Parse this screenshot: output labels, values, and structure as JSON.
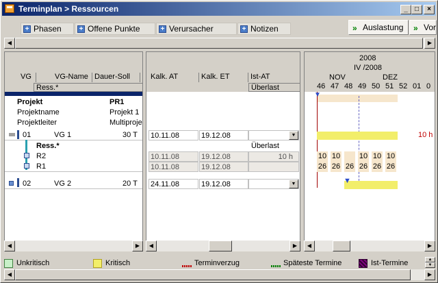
{
  "window": {
    "title": "Terminplan > Ressourcen",
    "btn_min": "_",
    "btn_max": "□",
    "btn_close": "×"
  },
  "toolbar": {
    "phasen": "Phasen",
    "offene_punkte": "Offene Punkte",
    "verursacher": "Verursacher",
    "notizen": "Notizen",
    "auslastung": "Auslastung",
    "vor": "Vor"
  },
  "left_pane": {
    "col_vg": "VG",
    "col_vg_name": "VG-Name",
    "col_dauer_soll": "Dauer-Soll",
    "col_extra": "I",
    "sub_ress": "Ress.*",
    "projekt_label": "Projekt",
    "projekt_value": "PR1",
    "projektname_label": "Projektname",
    "projektname_value": "Projekt 1",
    "projektleiter_label": "Projektleiter",
    "projektleiter_value": "Multiproje",
    "row1_vg": "01",
    "row1_name": "VG 1",
    "row1_dauer": "30 T",
    "ress_header": "Ress.*",
    "res1": "R2",
    "res2": "R1",
    "row2_vg": "02",
    "row2_name": "VG 2",
    "row2_dauer": "20 T"
  },
  "mid_pane": {
    "col_kalk_at": "Kalk. AT",
    "col_kalk_et": "Kalk. ET",
    "col_ist_at": "Ist-AT",
    "sub_ueberlast": "Überlast",
    "row1_at": "10.11.08",
    "row1_et": "19.12.08",
    "ueberlast": "Überlast",
    "r2_at": "10.11.08",
    "r2_et": "19.12.08",
    "r2_load": "10 h",
    "r1_at": "10.11.08",
    "r1_et": "19.12.08",
    "row2_at": "24.11.08",
    "row2_et": "19.12.08"
  },
  "gantt": {
    "year": "2008",
    "quarter": "IV /2008",
    "month_nov": "NOV",
    "month_dez": "DEZ",
    "weeks": [
      "46",
      "47",
      "48",
      "49",
      "50",
      "51",
      "52",
      "01",
      "0"
    ],
    "load_label": "10 h",
    "r2_values": [
      "10",
      "10",
      "",
      "10",
      "10",
      "10"
    ],
    "r1_values": [
      "26",
      "26",
      "26",
      "26",
      "26",
      "26"
    ]
  },
  "legend": {
    "unkritisch": "Unkritisch",
    "kritisch": "Kritisch",
    "terminverzug": "Terminverzug",
    "spaeteste": "Späteste Termine",
    "ist_termine": "Ist-Termine"
  },
  "colors": {
    "kritisch": "#f2ee6a",
    "unkritisch": "#c8f0c8",
    "ist": "#800080",
    "selection": "#0a246a"
  }
}
